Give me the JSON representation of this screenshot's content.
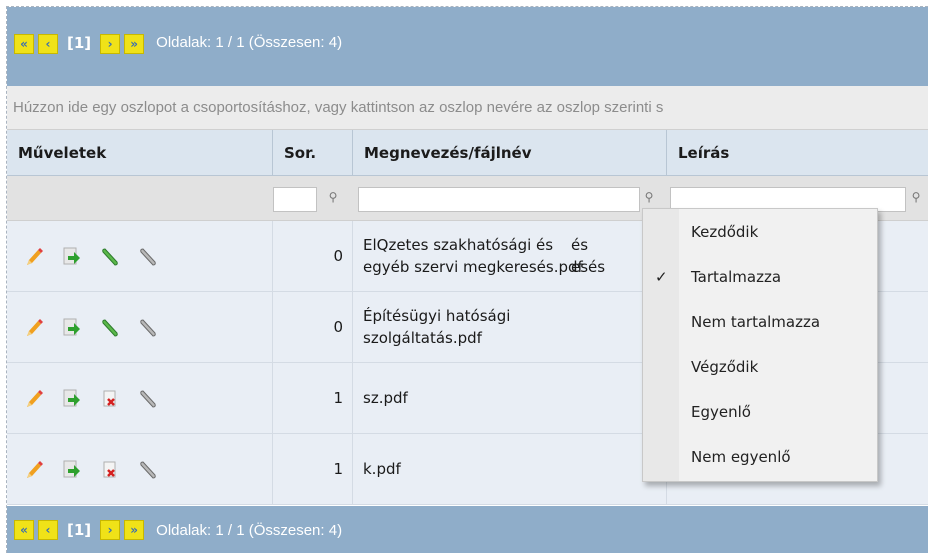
{
  "pager": {
    "first_icon": "double-left-arrow-icon",
    "prev_icon": "left-arrow-icon",
    "current_page": "[1]",
    "next_icon": "right-arrow-icon",
    "last_icon": "double-right-arrow-icon",
    "info": "Oldalak: 1 / 1 (Összesen: 4)"
  },
  "group_area": {
    "hint": "Húzzon ide egy oszlopot a csoportosításhoz, vagy kattintson az oszlop nevére az oszlop szerinti s"
  },
  "columns": {
    "actions": "Műveletek",
    "order": "Sor.",
    "name": "Megnevezés/fájlnév",
    "description": "Leírás"
  },
  "rows": [
    {
      "order": "0",
      "name_line1": "ElQzetes szakhatósági és",
      "name_line2": "egyéb szervi megkeresés.pdf",
      "desc_line1": "és",
      "desc_line2": "esés",
      "attach": "green"
    },
    {
      "order": "0",
      "name_line1": "Építésügyi hatósági",
      "name_line2": "szolgáltatás.pdf",
      "desc_line1": "",
      "desc_line2": "",
      "attach": "green"
    },
    {
      "order": "1",
      "name_line1": "sz.pdf",
      "name_line2": "",
      "desc_line1": "",
      "desc_line2": "",
      "attach": "delete"
    },
    {
      "order": "1",
      "name_line1": "k.pdf",
      "name_line2": "",
      "desc_line1": "",
      "desc_line2": "",
      "attach": "delete"
    }
  ],
  "filter_menu": {
    "items": [
      "Kezdődik",
      "Tartalmazza",
      "Nem tartalmazza",
      "Végződik",
      "Egyenlő",
      "Nem egyenlő"
    ],
    "checked_index": 1,
    "check_mark": "✓"
  },
  "colors": {
    "pager_bg": "#8fadc9",
    "pager_button": "#f0e218",
    "header_bg": "#dbe5ef",
    "row_bg": "#e9eef5"
  }
}
